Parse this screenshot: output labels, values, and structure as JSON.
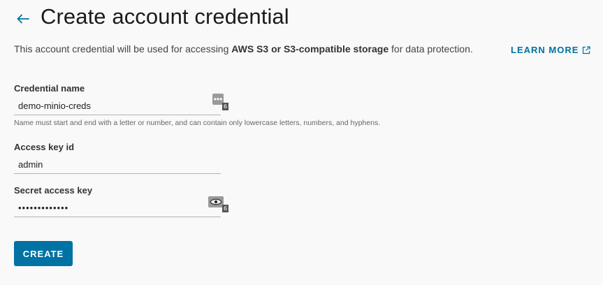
{
  "header": {
    "title": "Create account credential",
    "back_icon": "arrow-left-icon"
  },
  "description": {
    "prefix": "This account credential will be used for accessing ",
    "bold": "AWS S3 or S3-compatible storage",
    "suffix": " for data protection.",
    "link_label": "LEARN MORE",
    "link_icon": "external-link-icon"
  },
  "form": {
    "credential_name": {
      "label": "Credential name",
      "value": "demo-minio-creds",
      "helper": "Name must start and end with a letter or number, and can contain only lowercase letters, numbers, and hyphens.",
      "badge": "6"
    },
    "access_key_id": {
      "label": "Access key id",
      "value": "admin"
    },
    "secret_access_key": {
      "label": "Secret access key",
      "value": "•••••••••••••",
      "badge": "6"
    }
  },
  "actions": {
    "create_label": "CREATE"
  },
  "colors": {
    "accent": "#0072a3",
    "background": "#f9f9f9"
  }
}
